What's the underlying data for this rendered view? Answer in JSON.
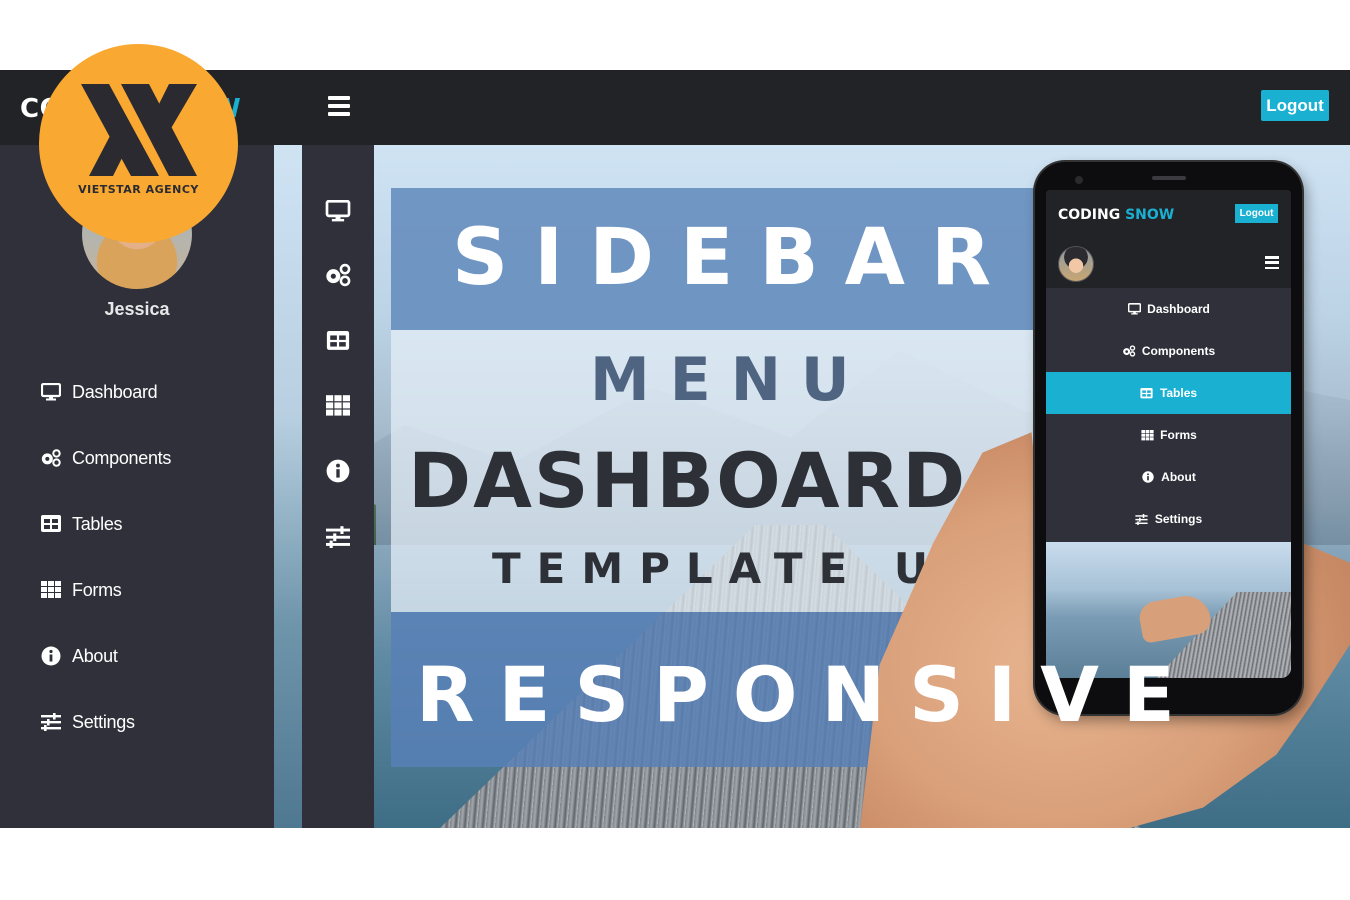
{
  "header": {
    "brand_part1": "CODING ",
    "brand_part2": "SNOW",
    "logout_label": "Logout"
  },
  "watermark": {
    "text": "VIETSTAR AGENCY"
  },
  "sidebar": {
    "username": "Jessica",
    "items": [
      {
        "label": "Dashboard",
        "icon": "desktop-icon"
      },
      {
        "label": "Components",
        "icon": "cogs-icon"
      },
      {
        "label": "Tables",
        "icon": "table-icon"
      },
      {
        "label": "Forms",
        "icon": "grid-icon"
      },
      {
        "label": "About",
        "icon": "info-icon"
      },
      {
        "label": "Settings",
        "icon": "sliders-icon"
      }
    ]
  },
  "poster": {
    "line1": "SIDEBAR",
    "line2": "MENU",
    "line3": "DASHBOARD",
    "line4": "TEMPLATE UI",
    "line5": "RESPONSIVE"
  },
  "mobile": {
    "brand_part1": "CODING ",
    "brand_part2": "SNOW",
    "logout_label": "Logout",
    "active_item": "Tables",
    "items": [
      {
        "label": "Dashboard",
        "icon": "desktop-icon"
      },
      {
        "label": "Components",
        "icon": "cogs-icon"
      },
      {
        "label": "Tables",
        "icon": "table-icon"
      },
      {
        "label": "Forms",
        "icon": "grid-icon"
      },
      {
        "label": "About",
        "icon": "info-icon"
      },
      {
        "label": "Settings",
        "icon": "sliders-icon"
      }
    ]
  },
  "colors": {
    "accent": "#1ab0d2",
    "sidebar_bg": "#2f3039",
    "header_bg": "#222327",
    "badge": "#f9a932"
  }
}
